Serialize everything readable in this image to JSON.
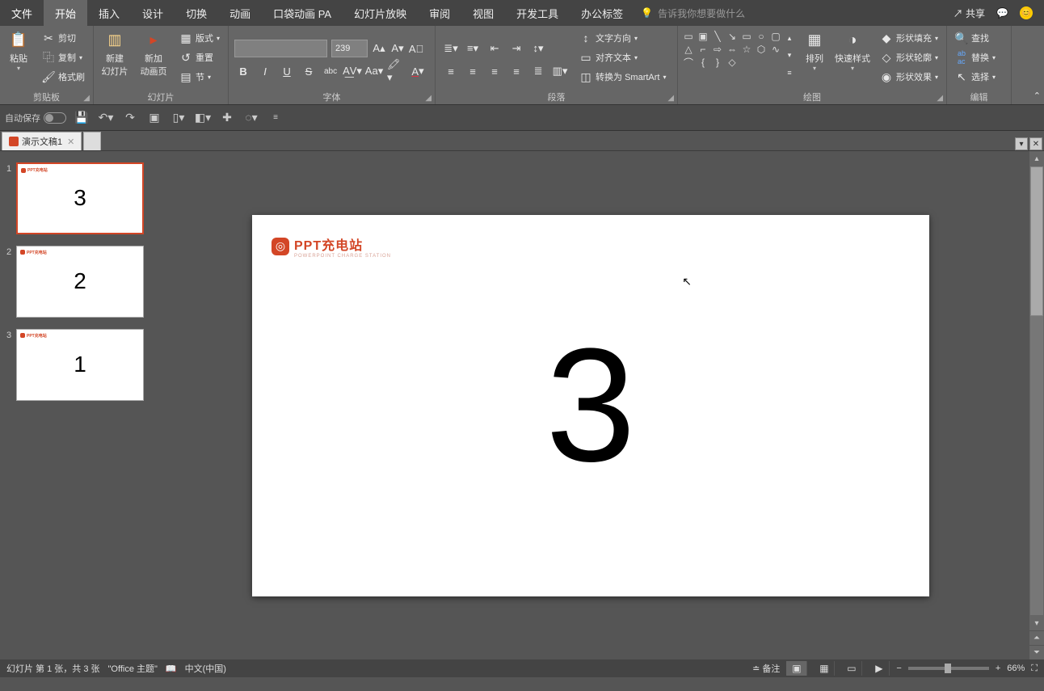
{
  "menubar": {
    "tabs": [
      "文件",
      "开始",
      "插入",
      "设计",
      "切换",
      "动画",
      "口袋动画 PA",
      "幻灯片放映",
      "审阅",
      "视图",
      "开发工具",
      "办公标签"
    ],
    "active_index": 1,
    "tellme_placeholder": "告诉我你想要做什么",
    "share": "共享"
  },
  "ribbon": {
    "clipboard": {
      "paste": "粘贴",
      "cut": "剪切",
      "copy": "复制",
      "format_painter": "格式刷",
      "label": "剪贴板"
    },
    "slides": {
      "new_slide": "新建\n幻灯片",
      "new_anim": "新加\n动画页",
      "layout": "版式",
      "reset": "重置",
      "section": "节",
      "label": "幻灯片"
    },
    "font": {
      "size": "239",
      "label": "字体"
    },
    "paragraph": {
      "text_direction": "文字方向",
      "align_text": "对齐文本",
      "smartart": "转换为 SmartArt",
      "label": "段落"
    },
    "drawing": {
      "arrange": "排列",
      "quick_styles": "快速样式",
      "shape_fill": "形状填充",
      "shape_outline": "形状轮廓",
      "shape_effects": "形状效果",
      "label": "绘图"
    },
    "editing": {
      "find": "查找",
      "replace": "替换",
      "select": "选择",
      "label": "编辑"
    }
  },
  "qat": {
    "autosave": "自动保存"
  },
  "doc": {
    "name": "演示文稿1"
  },
  "thumbnails": [
    {
      "num": "1",
      "content": "3",
      "selected": true
    },
    {
      "num": "2",
      "content": "2",
      "selected": false
    },
    {
      "num": "3",
      "content": "1",
      "selected": false
    }
  ],
  "slide": {
    "logo_text": "PPT充电站",
    "content": "3"
  },
  "status": {
    "slide_info": "幻灯片 第 1 张，共 3 张",
    "theme": "\"Office 主题\"",
    "lang": "中文(中国)",
    "notes": "备注",
    "zoom": "66%"
  }
}
